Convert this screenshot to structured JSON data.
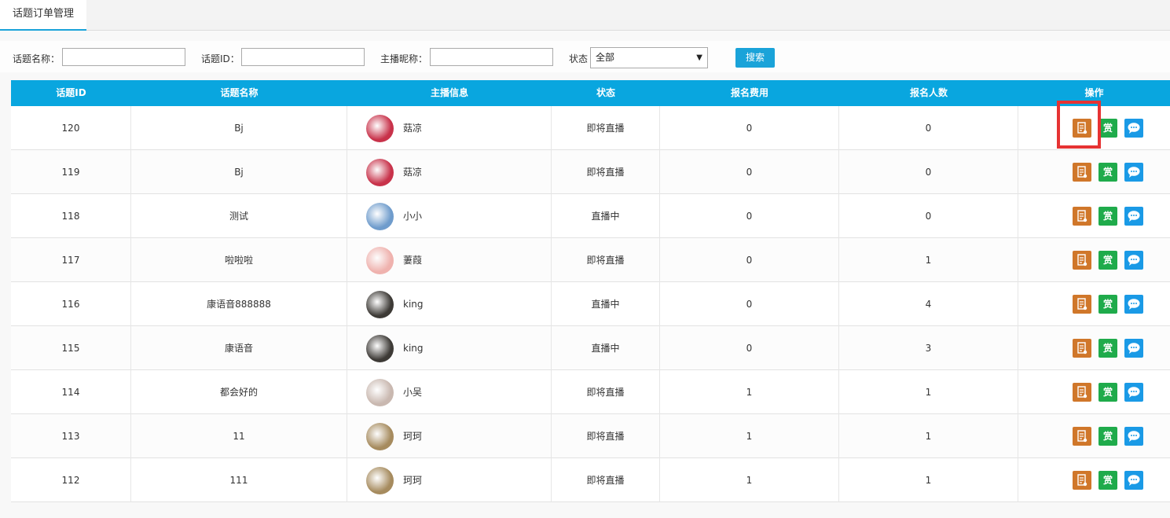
{
  "tab": {
    "label": "话题订单管理"
  },
  "filters": {
    "topic_name_label": "话题名称：",
    "topic_id_label": "话题ID：",
    "host_nick_label": "主播昵称：",
    "status_label": "状态",
    "status_selected": "全部",
    "search_label": "搜索"
  },
  "table": {
    "headers": [
      "话题ID",
      "话题名称",
      "主播信息",
      "状态",
      "报名费用",
      "报名人数",
      "操作"
    ],
    "rows": [
      {
        "id": "120",
        "name": "Bj",
        "host": "菇凉",
        "status": "即将直播",
        "fee": "0",
        "count": "0",
        "avatar_color": "#c8324a"
      },
      {
        "id": "119",
        "name": "Bj",
        "host": "菇凉",
        "status": "即将直播",
        "fee": "0",
        "count": "0",
        "avatar_color": "#c8324a"
      },
      {
        "id": "118",
        "name": "测试",
        "host": "小小",
        "status": "直播中",
        "fee": "0",
        "count": "0",
        "avatar_color": "#6f9ccc"
      },
      {
        "id": "117",
        "name": "啦啦啦",
        "host": "萋葭",
        "status": "即将直播",
        "fee": "0",
        "count": "1",
        "avatar_color": "#efb2ae"
      },
      {
        "id": "116",
        "name": "康语音888888",
        "host": "king",
        "status": "直播中",
        "fee": "0",
        "count": "4",
        "avatar_color": "#3d3a36"
      },
      {
        "id": "115",
        "name": "康语音",
        "host": "king",
        "status": "直播中",
        "fee": "0",
        "count": "3",
        "avatar_color": "#3d3a36"
      },
      {
        "id": "114",
        "name": "都会好的",
        "host": "小吴",
        "status": "即将直播",
        "fee": "1",
        "count": "1",
        "avatar_color": "#c9b8b0"
      },
      {
        "id": "113",
        "name": "11",
        "host": "珂珂",
        "status": "即将直播",
        "fee": "1",
        "count": "1",
        "avatar_color": "#a68b5e"
      },
      {
        "id": "112",
        "name": "111",
        "host": "珂珂",
        "status": "即将直播",
        "fee": "1",
        "count": "1",
        "avatar_color": "#a68b5e"
      }
    ]
  },
  "ops": {
    "reward_glyph": "赏"
  },
  "colors": {
    "header_bg": "#09a6df",
    "accent": "#1aa3d9",
    "highlight": "#e63333"
  }
}
